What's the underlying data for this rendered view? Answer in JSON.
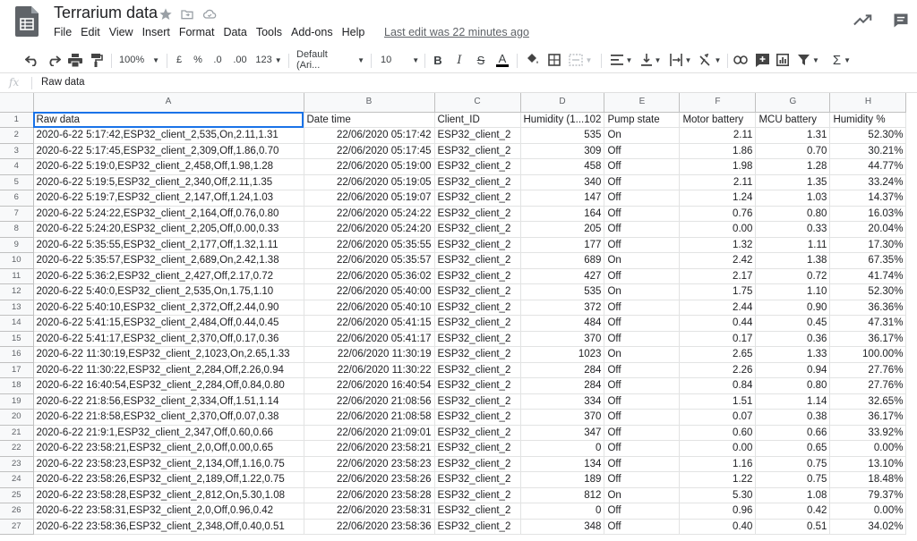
{
  "document": {
    "title": "Terrarium data",
    "last_edit": "Last edit was 22 minutes ago"
  },
  "menu": [
    "File",
    "Edit",
    "View",
    "Insert",
    "Format",
    "Data",
    "Tools",
    "Add-ons",
    "Help"
  ],
  "toolbar": {
    "zoom": "100%",
    "currency": "£",
    "percent": "%",
    "decrease_decimals": ".0",
    "increase_decimals": ".00",
    "more_formats": "123",
    "font_family": "Default (Ari...",
    "font_size": "10",
    "bold": "B",
    "italic": "I",
    "strikethrough": "S",
    "text_color": "A",
    "text_color_value": "#000000"
  },
  "formula_bar": {
    "fx_label": "fx",
    "content": "Raw data"
  },
  "icons": {
    "logo": "sheets-logo-icon",
    "star": "star-icon",
    "move": "folder-move-icon",
    "cloud": "cloud-saved-icon",
    "trend": "explore-trend-icon",
    "comments": "comments-icon"
  },
  "colors": {
    "logo_green": "#0f9d58",
    "selection_blue": "#1a73e8"
  },
  "sheet": {
    "column_letters": [
      "A",
      "B",
      "C",
      "D",
      "E",
      "F",
      "G",
      "H"
    ],
    "rows": [
      [
        "Raw data",
        "Date time",
        "Client_ID",
        "Humidity (1...102",
        "Pump state",
        "Motor battery",
        "MCU battery",
        "Humidity %"
      ],
      [
        "2020-6-22 5:17:42,ESP32_client_2,535,On,2.11,1.31",
        "22/06/2020 05:17:42",
        "ESP32_client_2",
        "535",
        "On",
        "2.11",
        "1.31",
        "52.30%"
      ],
      [
        "2020-6-22 5:17:45,ESP32_client_2,309,Off,1.86,0.70",
        "22/06/2020 05:17:45",
        "ESP32_client_2",
        "309",
        "Off",
        "1.86",
        "0.70",
        "30.21%"
      ],
      [
        "2020-6-22 5:19:0,ESP32_client_2,458,Off,1.98,1.28",
        "22/06/2020 05:19:00",
        "ESP32_client_2",
        "458",
        "Off",
        "1.98",
        "1.28",
        "44.77%"
      ],
      [
        "2020-6-22 5:19:5,ESP32_client_2,340,Off,2.11,1.35",
        "22/06/2020 05:19:05",
        "ESP32_client_2",
        "340",
        "Off",
        "2.11",
        "1.35",
        "33.24%"
      ],
      [
        "2020-6-22 5:19:7,ESP32_client_2,147,Off,1.24,1.03",
        "22/06/2020 05:19:07",
        "ESP32_client_2",
        "147",
        "Off",
        "1.24",
        "1.03",
        "14.37%"
      ],
      [
        "2020-6-22 5:24:22,ESP32_client_2,164,Off,0.76,0.80",
        "22/06/2020 05:24:22",
        "ESP32_client_2",
        "164",
        "Off",
        "0.76",
        "0.80",
        "16.03%"
      ],
      [
        "2020-6-22 5:24:20,ESP32_client_2,205,Off,0.00,0.33",
        "22/06/2020 05:24:20",
        "ESP32_client_2",
        "205",
        "Off",
        "0.00",
        "0.33",
        "20.04%"
      ],
      [
        "2020-6-22 5:35:55,ESP32_client_2,177,Off,1.32,1.11",
        "22/06/2020 05:35:55",
        "ESP32_client_2",
        "177",
        "Off",
        "1.32",
        "1.11",
        "17.30%"
      ],
      [
        "2020-6-22 5:35:57,ESP32_client_2,689,On,2.42,1.38",
        "22/06/2020 05:35:57",
        "ESP32_client_2",
        "689",
        "On",
        "2.42",
        "1.38",
        "67.35%"
      ],
      [
        "2020-6-22 5:36:2,ESP32_client_2,427,Off,2.17,0.72",
        "22/06/2020 05:36:02",
        "ESP32_client_2",
        "427",
        "Off",
        "2.17",
        "0.72",
        "41.74%"
      ],
      [
        "2020-6-22 5:40:0,ESP32_client_2,535,On,1.75,1.10",
        "22/06/2020 05:40:00",
        "ESP32_client_2",
        "535",
        "On",
        "1.75",
        "1.10",
        "52.30%"
      ],
      [
        "2020-6-22 5:40:10,ESP32_client_2,372,Off,2.44,0.90",
        "22/06/2020 05:40:10",
        "ESP32_client_2",
        "372",
        "Off",
        "2.44",
        "0.90",
        "36.36%"
      ],
      [
        "2020-6-22 5:41:15,ESP32_client_2,484,Off,0.44,0.45",
        "22/06/2020 05:41:15",
        "ESP32_client_2",
        "484",
        "Off",
        "0.44",
        "0.45",
        "47.31%"
      ],
      [
        "2020-6-22 5:41:17,ESP32_client_2,370,Off,0.17,0.36",
        "22/06/2020 05:41:17",
        "ESP32_client_2",
        "370",
        "Off",
        "0.17",
        "0.36",
        "36.17%"
      ],
      [
        "2020-6-22 11:30:19,ESP32_client_2,1023,On,2.65,1.33",
        "22/06/2020 11:30:19",
        "ESP32_client_2",
        "1023",
        "On",
        "2.65",
        "1.33",
        "100.00%"
      ],
      [
        "2020-6-22 11:30:22,ESP32_client_2,284,Off,2.26,0.94",
        "22/06/2020 11:30:22",
        "ESP32_client_2",
        "284",
        "Off",
        "2.26",
        "0.94",
        "27.76%"
      ],
      [
        "2020-6-22 16:40:54,ESP32_client_2,284,Off,0.84,0.80",
        "22/06/2020 16:40:54",
        "ESP32_client_2",
        "284",
        "Off",
        "0.84",
        "0.80",
        "27.76%"
      ],
      [
        "2020-6-22 21:8:56,ESP32_client_2,334,Off,1.51,1.14",
        "22/06/2020 21:08:56",
        "ESP32_client_2",
        "334",
        "Off",
        "1.51",
        "1.14",
        "32.65%"
      ],
      [
        "2020-6-22 21:8:58,ESP32_client_2,370,Off,0.07,0.38",
        "22/06/2020 21:08:58",
        "ESP32_client_2",
        "370",
        "Off",
        "0.07",
        "0.38",
        "36.17%"
      ],
      [
        "2020-6-22 21:9:1,ESP32_client_2,347,Off,0.60,0.66",
        "22/06/2020 21:09:01",
        "ESP32_client_2",
        "347",
        "Off",
        "0.60",
        "0.66",
        "33.92%"
      ],
      [
        "2020-6-22 23:58:21,ESP32_client_2,0,Off,0.00,0.65",
        "22/06/2020 23:58:21",
        "ESP32_client_2",
        "0",
        "Off",
        "0.00",
        "0.65",
        "0.00%"
      ],
      [
        "2020-6-22 23:58:23,ESP32_client_2,134,Off,1.16,0.75",
        "22/06/2020 23:58:23",
        "ESP32_client_2",
        "134",
        "Off",
        "1.16",
        "0.75",
        "13.10%"
      ],
      [
        "2020-6-22 23:58:26,ESP32_client_2,189,Off,1.22,0.75",
        "22/06/2020 23:58:26",
        "ESP32_client_2",
        "189",
        "Off",
        "1.22",
        "0.75",
        "18.48%"
      ],
      [
        "2020-6-22 23:58:28,ESP32_client_2,812,On,5.30,1.08",
        "22/06/2020 23:58:28",
        "ESP32_client_2",
        "812",
        "On",
        "5.30",
        "1.08",
        "79.37%"
      ],
      [
        "2020-6-22 23:58:31,ESP32_client_2,0,Off,0.96,0.42",
        "22/06/2020 23:58:31",
        "ESP32_client_2",
        "0",
        "Off",
        "0.96",
        "0.42",
        "0.00%"
      ],
      [
        "2020-6-22 23:58:36,ESP32_client_2,348,Off,0.40,0.51",
        "22/06/2020 23:58:36",
        "ESP32_client_2",
        "348",
        "Off",
        "0.40",
        "0.51",
        "34.02%"
      ]
    ]
  }
}
